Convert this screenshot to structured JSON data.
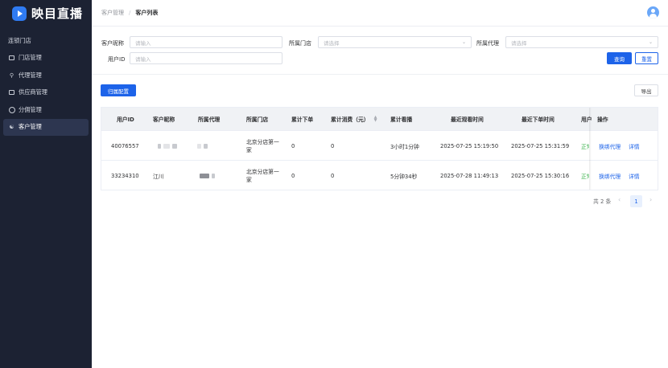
{
  "app": {
    "logo_text": "映目直播",
    "brand_color": "#2f7bf3",
    "sidebar_bg": "#1c2233"
  },
  "sidebar": {
    "items": [
      {
        "label": "连锁门店",
        "icon": "none"
      },
      {
        "label": "门店管理",
        "icon": "store-icon"
      },
      {
        "label": "代理管理",
        "icon": "person-icon"
      },
      {
        "label": "供应商管理",
        "icon": "supplier-icon"
      },
      {
        "label": "分佣管理",
        "icon": "commission-icon"
      },
      {
        "label": "客户管理",
        "icon": "customers-icon",
        "active": true
      }
    ]
  },
  "header": {
    "breadcrumb_parent": "客户管理",
    "breadcrumb_sep": "/",
    "breadcrumb_current": "客户列表"
  },
  "filters": {
    "nickname_label": "客户昵称",
    "nickname_placeholder": "请输入",
    "store_label": "所属门店",
    "store_placeholder": "请选择",
    "agent_label": "所属代理",
    "agent_placeholder": "请选择",
    "userid_label": "用户ID",
    "userid_placeholder": "请输入",
    "search_label": "查询",
    "reset_label": "重置"
  },
  "toolbar": {
    "assign_label": "归属配置",
    "export_label": "导出"
  },
  "table": {
    "columns": [
      "用户ID",
      "客户昵称",
      "所属代理",
      "所属门店",
      "累计下单",
      "累计消费（元）",
      "累计看播",
      "最近观看时间",
      "最近下单时间",
      "用户",
      "操作"
    ],
    "rows": [
      {
        "user_id": "40076557",
        "nickname": "",
        "agent": "",
        "store": "北京分店第一家",
        "orders": "0",
        "spend": "0",
        "watch": "3小时1分钟",
        "last_watch": "2025-07-25 15:19:50",
        "last_order": "2025-07-25 15:31:59",
        "status": "正常",
        "action_rebind": "换绑代理",
        "action_detail": "详情"
      },
      {
        "user_id": "33234310",
        "nickname": "江川",
        "agent": "",
        "store": "北京分店第一家",
        "orders": "0",
        "spend": "0",
        "watch": "5分钟34秒",
        "last_watch": "2025-07-28 11:49:13",
        "last_order": "2025-07-25 15:30:16",
        "status": "正常",
        "action_rebind": "换绑代理",
        "action_detail": "详情"
      }
    ]
  },
  "pagination": {
    "total": "共 2 条",
    "current_page": "1",
    "prev": "‹",
    "next": "›"
  },
  "colors": {
    "primary": "#1d63e9",
    "status_ok": "#38b24a"
  }
}
